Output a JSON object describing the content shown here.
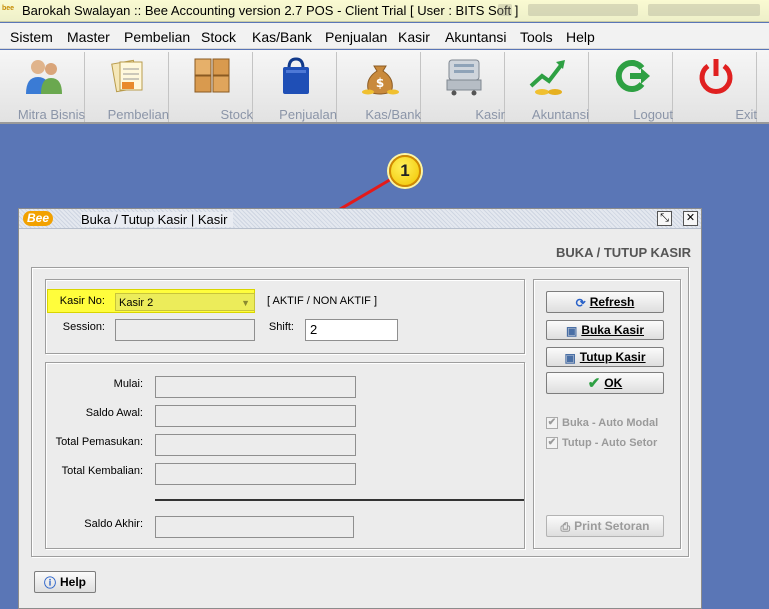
{
  "window": {
    "title": "Barokah Swalayan :: Bee Accounting version 2.7 POS - Client Trial [ User : BITS Soft ]",
    "app_icon_text": "bee"
  },
  "menu": [
    "Sistem",
    "Master",
    "Pembelian",
    "Stock",
    "Kas/Bank",
    "Penjualan",
    "Kasir",
    "Akuntansi",
    "Tools",
    "Help"
  ],
  "toolbar": [
    "Mitra Bisnis",
    "Pembelian",
    "Stock",
    "Penjualan",
    "Kas/Bank",
    "Kasir",
    "Akuntansi",
    "Logout",
    "Exit"
  ],
  "annotation": {
    "number": "1"
  },
  "dialog": {
    "logo": "Bee",
    "title": "Buka / Tutup Kasir | Kasir",
    "section_title": "BUKA / TUTUP KASIR",
    "kasir_label": "Kasir No:",
    "kasir_value": "Kasir 2",
    "status_text": "[ AKTIF  / NON AKTIF ]",
    "session_label": "Session:",
    "session_value": "",
    "shift_label": "Shift:",
    "shift_value": "2",
    "mulai_label": "Mulai:",
    "saldo_awal_label": "Saldo Awal:",
    "total_pemasukan_label": "Total Pemasukan:",
    "total_kembalian_label": "Total Kembalian:",
    "saldo_akhir_label": "Saldo Akhir:",
    "buttons": {
      "refresh": "Refresh",
      "buka_kasir": "Buka Kasir",
      "tutup_kasir": "Tutup Kasir",
      "ok": "OK",
      "print_setoran": "Print Setoran",
      "help": "Help"
    },
    "checkboxes": {
      "buka_auto_modal": "Buka - Auto Modal",
      "tutup_auto_setor": "Tutup - Auto Setor"
    }
  },
  "colors": {
    "desktop": "#5a76b6",
    "highlight": "#fffd3c",
    "arrow": "#e41a1a",
    "annotation": "#f2c400"
  }
}
